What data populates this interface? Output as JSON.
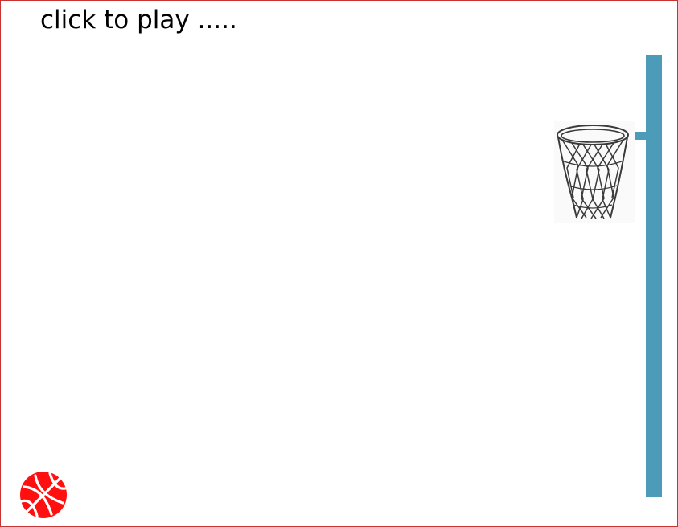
{
  "game": {
    "prompt_text": "click to play ....."
  },
  "colors": {
    "frame_border": "#c83232",
    "pole": "#4b9bb9",
    "ball": "#ff1010",
    "net": "#3a3a3a",
    "background": "#ffffff"
  },
  "icons": {
    "ball": "basketball-icon",
    "hoop": "basketball-hoop-icon"
  }
}
